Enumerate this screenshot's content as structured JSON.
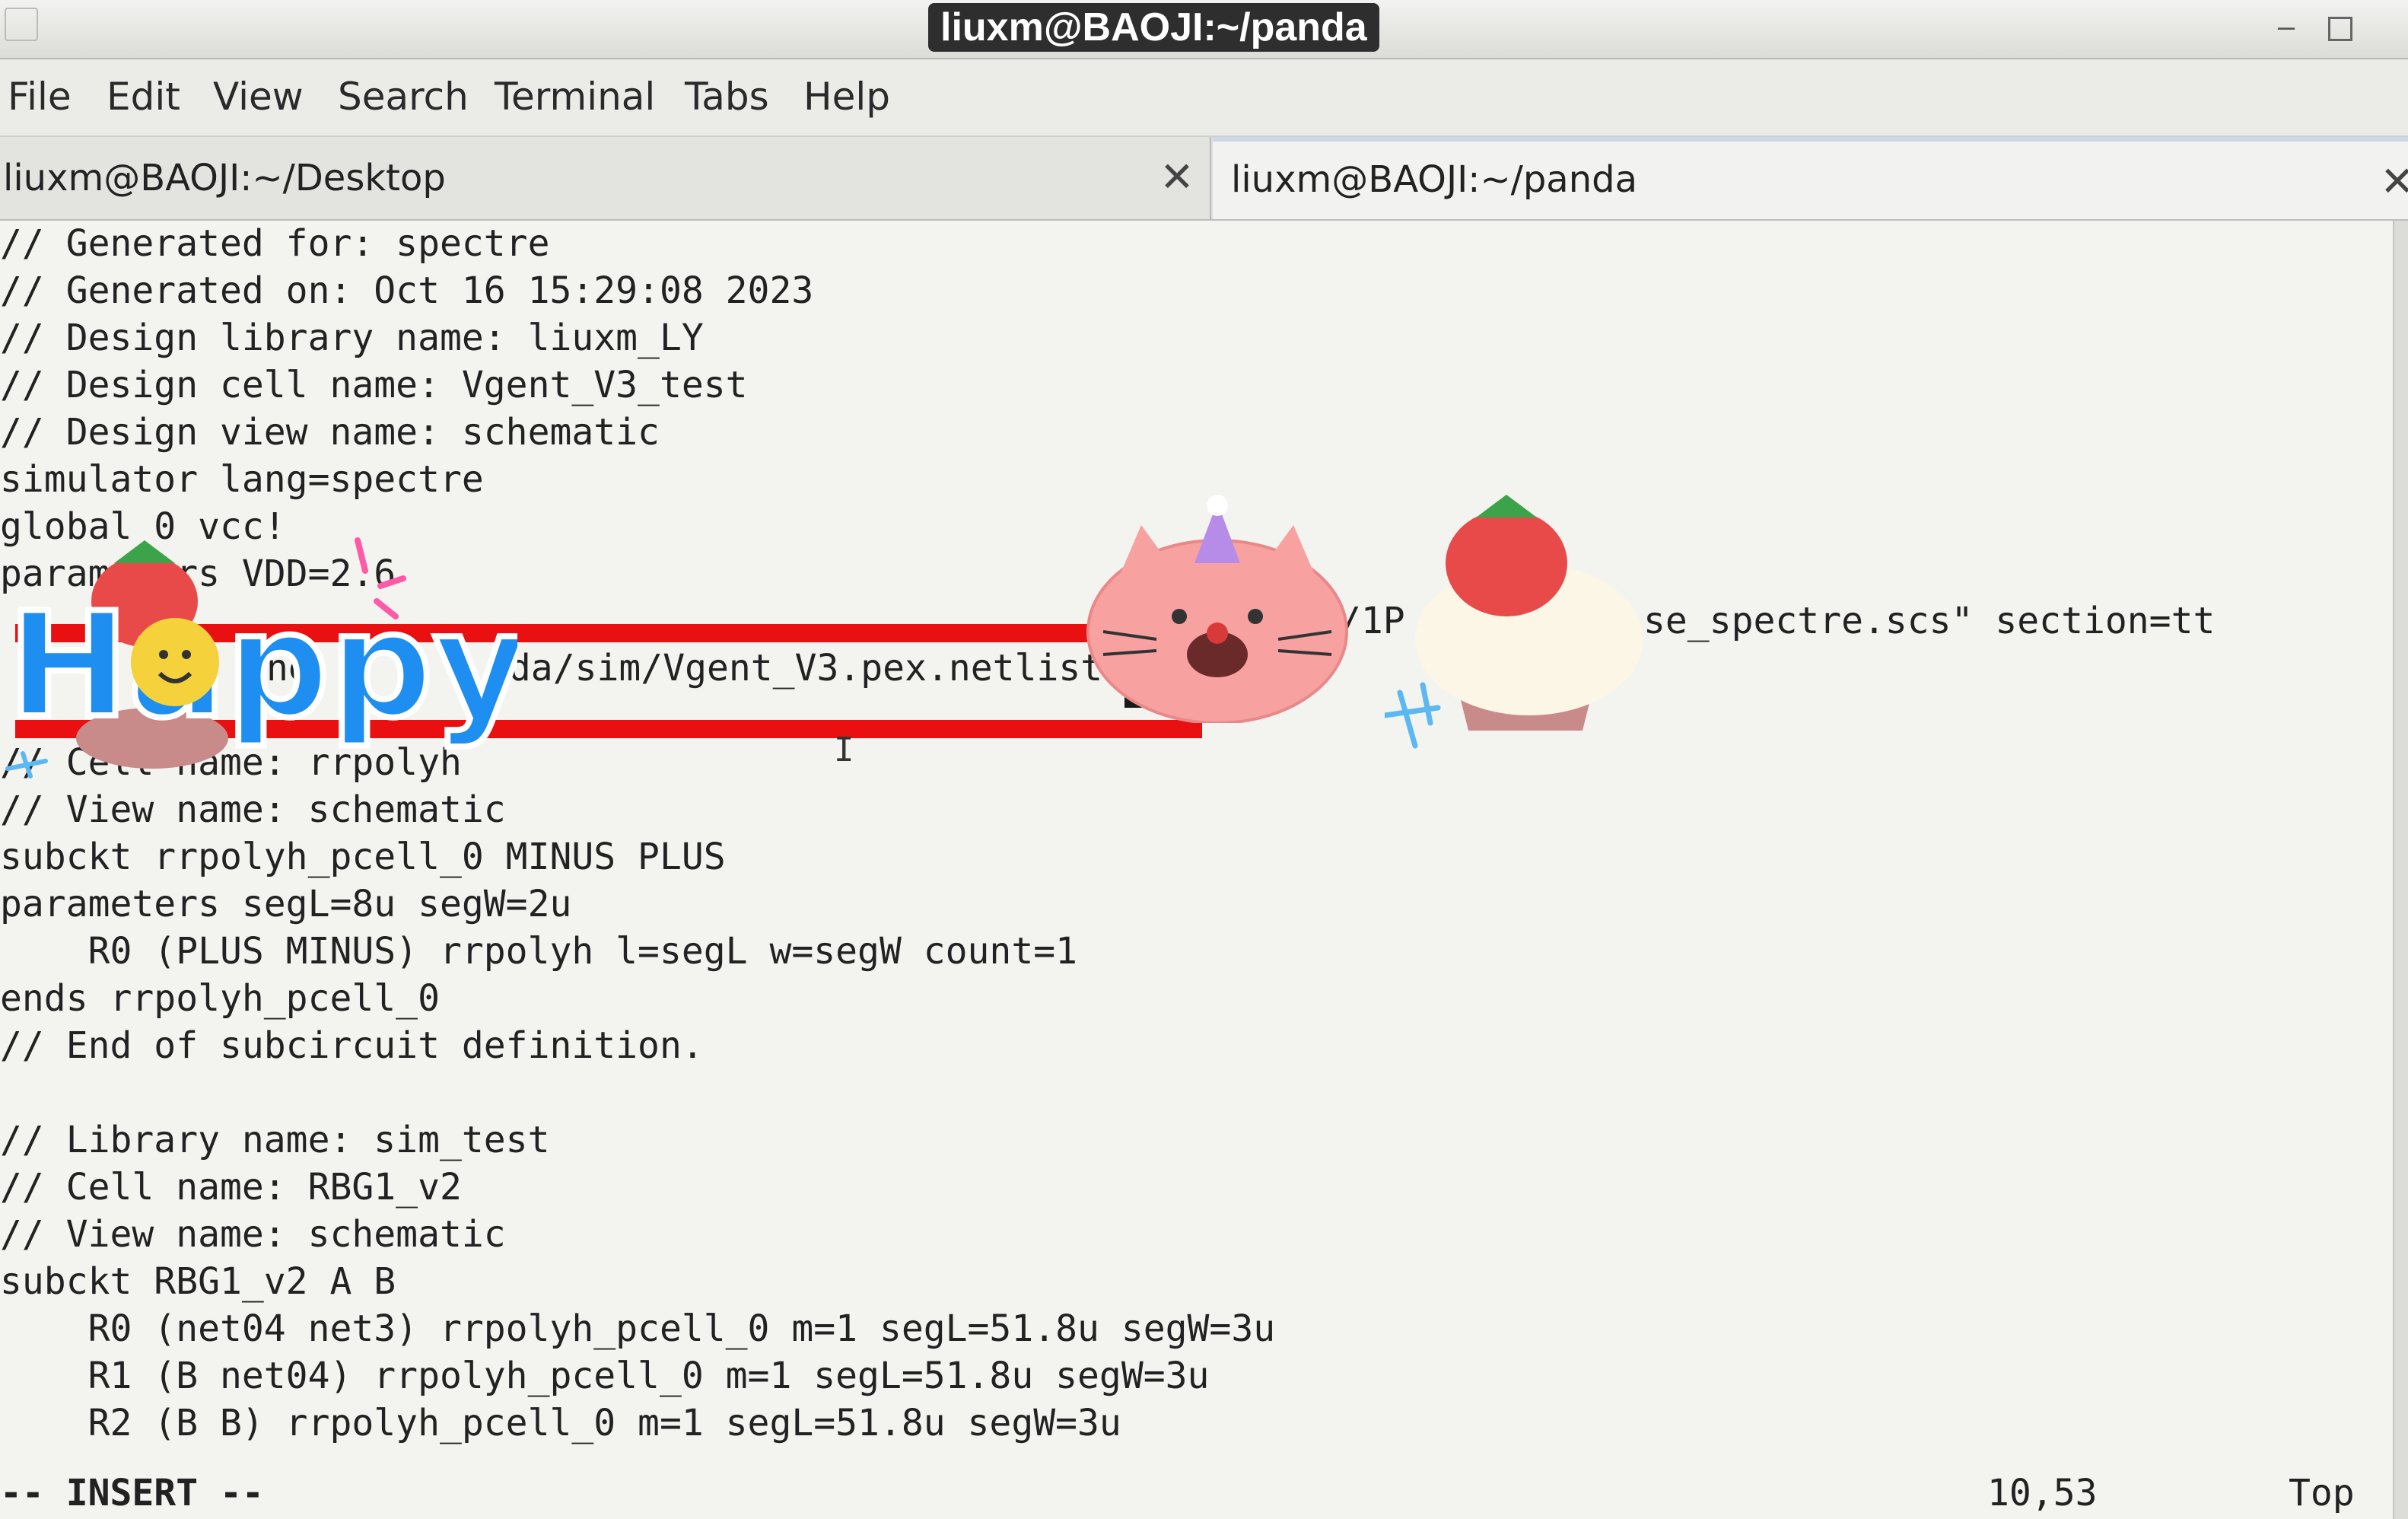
{
  "window": {
    "title": "liuxm@BAOJI:~/panda"
  },
  "menu": [
    "File",
    "Edit",
    "View",
    "Search",
    "Terminal",
    "Tabs",
    "Help"
  ],
  "tabs": [
    {
      "label": "liuxm@BAOJI:~/Desktop",
      "active": false
    },
    {
      "label": "liuxm@BAOJI:~/panda",
      "active": true
    }
  ],
  "terminal": {
    "lines": [
      "// Generated for: spectre",
      "// Generated on: Oct 16 15:29:08 2023",
      "// Design library name: liuxm_LY",
      "// Design cell name: Vgent_V3_test",
      "// Design view name: schematic",
      "simulator lang=spectre",
      "global 0 vcc!",
      "parameters VDD=2.6",
      "",
      "",
      "",
      "// Cell name: rrpolyh",
      "// View name: schematic",
      "subckt rrpolyh_pcell_0 MINUS PLUS",
      "parameters segL=8u segW=2u",
      "    R0 (PLUS MINUS) rrpolyh l=segL w=segW count=1",
      "ends rrpolyh_pcell_0",
      "// End of subcircuit definition.",
      "",
      "// Library name: sim_test",
      "// Cell name: RBG1_v2",
      "// View name: schematic",
      "subckt RBG1_v2 A B",
      "    R0 (net04 net3) rrpolyh_pcell_0 m=1 segL=51.8u segW=3u",
      "    R1 (B net04) rrpolyh_pcell_0 m=1 segL=51.8u segW=3u",
      "    R2 (B B) rrpolyh_pcell_0 m=1 segL=51.8u segW=3u"
    ],
    "partial_line_1": "se_spectre.scs\" section=tt",
    "partial_line_2": "nda/sim/Vgent_V3.pex.netlist",
    "partial_line_1_prefix": "/1P",
    "partial_line_2_prefix": "ne",
    "status_mode": "-- INSERT --",
    "cursor_pos": "10,53",
    "scroll_pos": "Top"
  },
  "stickers": {
    "happy_text": "Happy"
  },
  "colors": {
    "redact_bar": "#e81010",
    "happy_blue": "#1e8ff0",
    "cat_pink": "#f7a1a1"
  }
}
